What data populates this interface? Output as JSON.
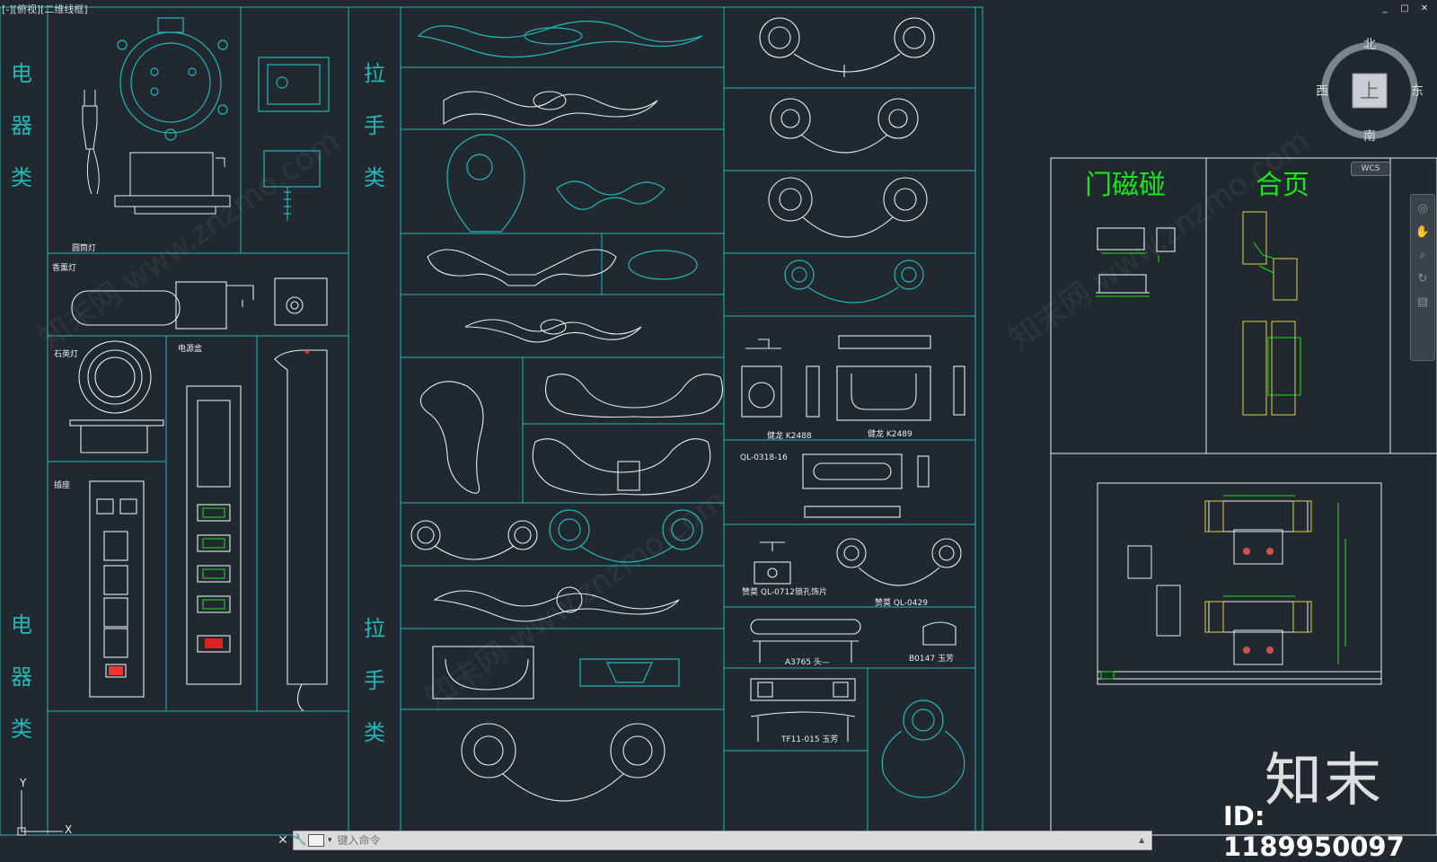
{
  "viewport": {
    "label": "[-][俯视][二维线框]"
  },
  "window_controls": [
    "_",
    "□",
    "✕"
  ],
  "compass": {
    "north": "北",
    "south": "南",
    "east": "东",
    "west": "西",
    "center": "上"
  },
  "wcs_label": "WCS",
  "command_line": {
    "placeholder": "键入命令"
  },
  "sections": {
    "electrical_top": "电器类",
    "electrical_bottom": "电器类",
    "handle_top": "拉手类",
    "handle_bottom": "拉手类",
    "door_stop": "门磁碰",
    "hinge": "合页"
  },
  "labels": {
    "round_lamp": "圆筒灯",
    "aroma_lamp": "香薰灯",
    "quartz_lamp": "石英灯",
    "power_box": "电源盒",
    "socket": "插座",
    "jianlong_k2488": "健龙 K2488",
    "jianlong_k2489": "健龙 K2489",
    "ql_0318_16": "QL-0318-16",
    "ql_0712": "赞莫 QL-0712锁孔饰片",
    "ql_0429": "赞莫 QL-0429",
    "a3765": "A3765 头—",
    "b0147": "B0147 玉芳",
    "tf11_015": "TF11-015 玉芳"
  },
  "axis": {
    "y": "Y",
    "x": "X"
  },
  "watermark": {
    "logo": "知末",
    "id": "ID: 1189950097",
    "text": "知末网 www.znzmo.com"
  },
  "colors": {
    "cyan": "#23b7b5",
    "white": "#e8ecef",
    "green": "#19e619",
    "yellow": "#d6d63a",
    "bg": "#212830"
  }
}
